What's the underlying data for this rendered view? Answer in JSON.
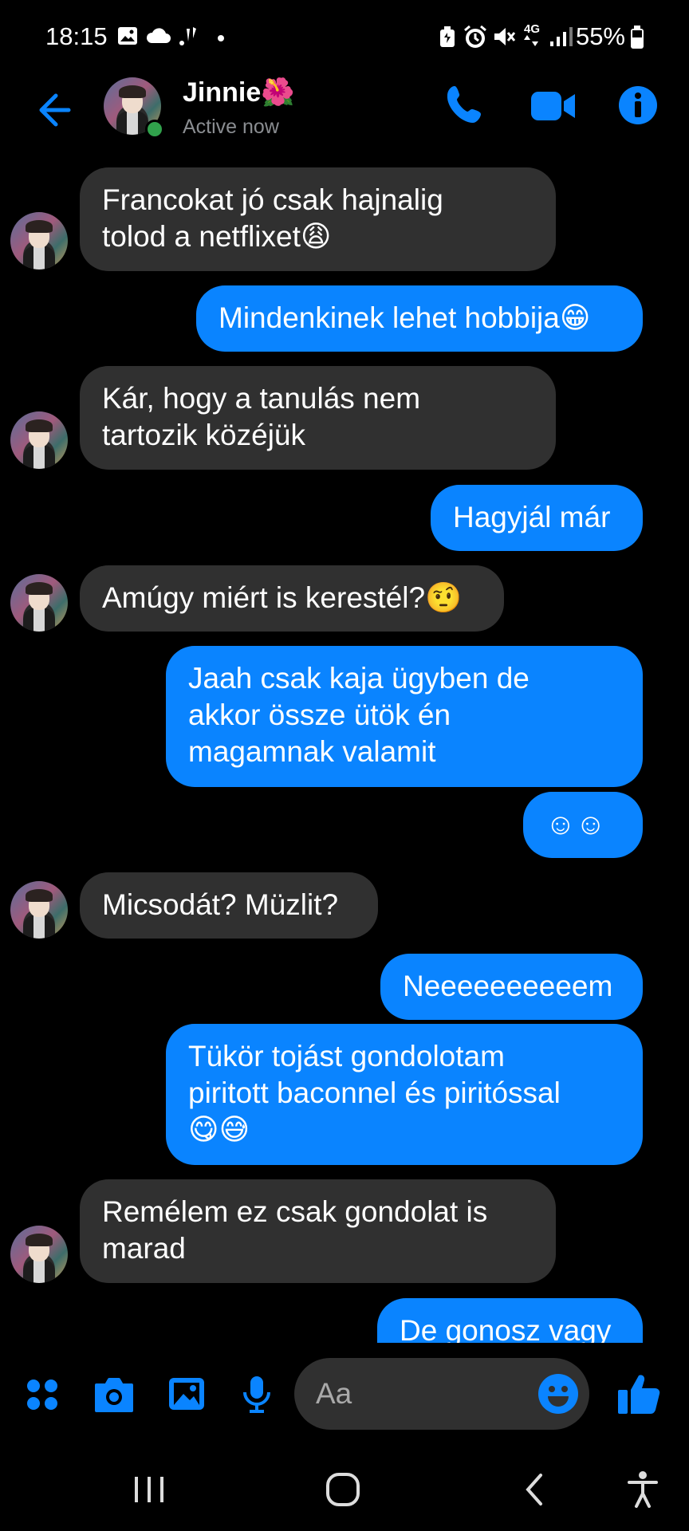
{
  "status_bar": {
    "time": "18:15",
    "battery": "55%",
    "network": "4G"
  },
  "header": {
    "contact_name": "Jinnie🌺",
    "contact_status": "Active now",
    "icons": [
      "back-arrow-icon",
      "phone-icon",
      "video-call-icon",
      "info-icon"
    ]
  },
  "messages": [
    {
      "dir": "in",
      "lines": [
        "Francokat jó csak hajnalig",
        "tolod a netflixet😩"
      ]
    },
    {
      "dir": "out",
      "lines": [
        "Mindenkinek lehet hobbija😁"
      ]
    },
    {
      "dir": "in",
      "lines": [
        "Kár, hogy a tanulás nem",
        "tartozik közéjük"
      ]
    },
    {
      "dir": "out",
      "lines": [
        "Hagyjál már"
      ]
    },
    {
      "dir": "in",
      "lines": [
        "Amúgy miért is kerestél?🤨"
      ]
    },
    {
      "dir": "out",
      "lines": [
        "Jaah csak kaja ügyben de",
        "akkor össze ütök én",
        "magamnak valamit"
      ]
    },
    {
      "dir": "out",
      "lines": [
        "☺☺"
      ]
    },
    {
      "dir": "in",
      "lines": [
        "Micsodát? Müzlit?"
      ]
    },
    {
      "dir": "out",
      "lines": [
        "Neeeeeeeeeem"
      ]
    },
    {
      "dir": "out",
      "lines": [
        "Tükör tojást gondolotam",
        "piritott baconnel és piritóssal",
        "😋😅"
      ]
    },
    {
      "dir": "in",
      "lines": [
        "Remélem ez csak gondolat is",
        "marad"
      ]
    },
    {
      "dir": "out",
      "lines": [
        "De gonosz vagy"
      ]
    }
  ],
  "composer": {
    "placeholder": "Aa",
    "icons": [
      "apps-icon",
      "camera-icon",
      "gallery-icon",
      "microphone-icon",
      "emoji-icon",
      "thumbs-up-icon"
    ]
  },
  "colors": {
    "accent": "#0a84ff",
    "incoming_bubble": "#303030",
    "background": "#000000",
    "online": "#31a24c"
  }
}
